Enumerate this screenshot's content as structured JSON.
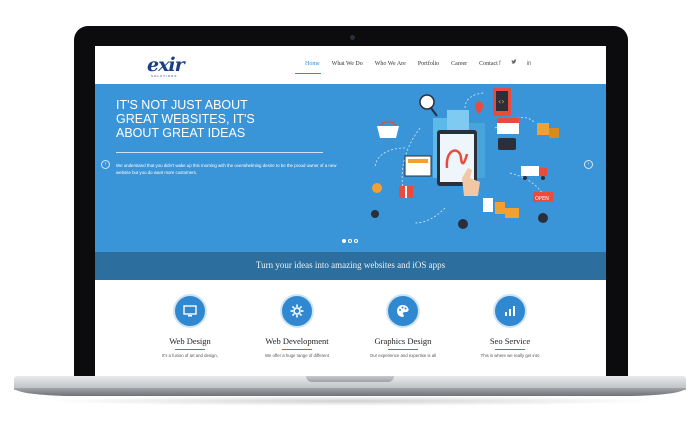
{
  "brand": {
    "logo_text": "exir",
    "logo_sub": "SOLUTIONS"
  },
  "nav": {
    "items": [
      {
        "label": "Home"
      },
      {
        "label": "What We Do"
      },
      {
        "label": "Who We Are"
      },
      {
        "label": "Portfolio"
      },
      {
        "label": "Career"
      },
      {
        "label": "Contact"
      }
    ],
    "active": "Home"
  },
  "social": {
    "facebook": "f",
    "twitter": "t",
    "linkedin": "in"
  },
  "hero": {
    "title_lines": [
      "IT'S NOT JUST ABOUT",
      "GREAT WEBSITES, IT'S",
      "ABOUT GREAT IDEAS"
    ],
    "description": "We understand that you didn't wake up this morning with the overwhelming desire to be the proud owner of a new website but you do want more customers.",
    "prev": "‹",
    "next": "›",
    "slides": 3,
    "active_slide": 1
  },
  "banner": {
    "text": "Turn your ideas into amazing websites and iOS apps"
  },
  "services": [
    {
      "title": "Web Design",
      "desc": "It's a fusion of art and design,",
      "icon": "monitor-icon"
    },
    {
      "title": "Web Development",
      "desc": "We offer a huge range of different",
      "icon": "gear-icon"
    },
    {
      "title": "Graphics Design",
      "desc": "Our experience and expertise is all",
      "icon": "palette-icon"
    },
    {
      "title": "Seo Service",
      "desc": "This is where we really get into",
      "icon": "chart-icon"
    }
  ],
  "colors": {
    "accent": "#3a94d8",
    "banner": "#2c6f9e",
    "brand": "#1b3f87"
  }
}
